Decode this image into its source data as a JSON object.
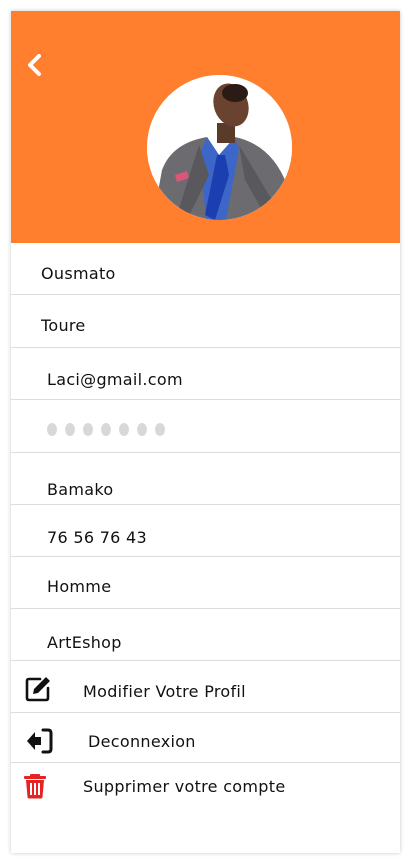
{
  "profile": {
    "first_name": "Ousmato",
    "last_name": "Toure",
    "email": "Laci@gmail.com",
    "password_masked": "•••••••",
    "city": "Bamako",
    "phone": "76 56 76 43",
    "gender": "Homme",
    "shop": "ArtEshop"
  },
  "actions": {
    "edit_label": "Modifier Votre Profil",
    "logout_label": "Deconnexion",
    "delete_label": "Supprimer votre compte"
  },
  "colors": {
    "header": "#FF7F2F",
    "delete_icon": "#E52323"
  },
  "icons": {
    "back": "chevron-left-icon",
    "edit": "edit-icon",
    "logout": "logout-icon",
    "delete": "trash-icon"
  }
}
